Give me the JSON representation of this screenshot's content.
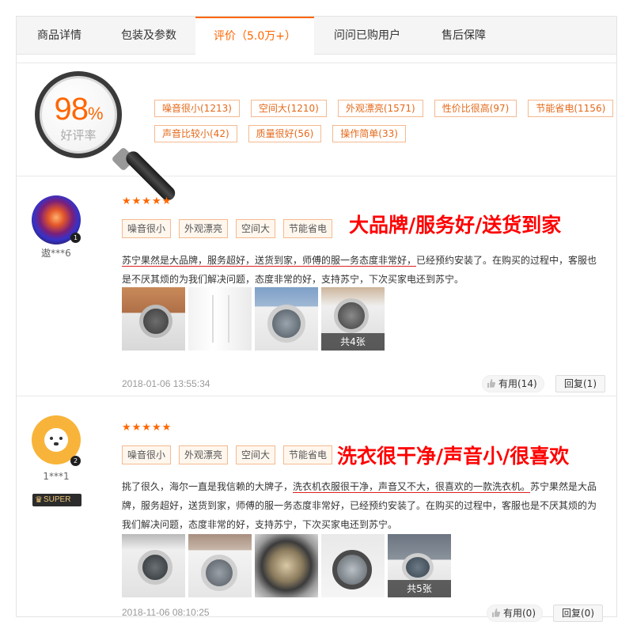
{
  "tabs": [
    {
      "label": "商品详情"
    },
    {
      "label": "包装及参数"
    },
    {
      "label": "评价（5.0万+）"
    },
    {
      "label": "问问已购用户"
    },
    {
      "label": "售后保障"
    }
  ],
  "summary": {
    "rate_value": "98",
    "rate_unit": "%",
    "rate_label": "好评率",
    "tags": [
      [
        "噪音很小(1213)",
        "空间大(1210)",
        "外观漂亮(1571)",
        "性价比很高(97)",
        "节能省电(1156)"
      ],
      [
        "声音比较小(42)",
        "质量很好(56)",
        "操作简单(33)"
      ]
    ]
  },
  "reviews": [
    {
      "username": "遨***6",
      "vip_level": "1",
      "stars": "★★★★★",
      "tags": [
        "噪音很小",
        "外观漂亮",
        "空间大",
        "节能省电"
      ],
      "overlay": "大品牌/服务好/送货到家",
      "text_underlined": "苏宁果然是大品牌，服务超好，送货到家，师傅的服一务态度非常好，",
      "text_rest": "已经预约安装了。在购买的过程中，客服也是不厌其烦的为我们解决问题，态度非常的好，支持苏宁，下次买家电还到苏宁。",
      "photo_count": "共4张",
      "date": "2018-01-06 13:55:34",
      "useful": "有用(14)",
      "reply": "回复(1)"
    },
    {
      "username": "1***1",
      "vip_level": "2",
      "badge": "SUPER",
      "stars": "★★★★★",
      "tags": [
        "噪音很小",
        "外观漂亮",
        "空间大",
        "节能省电"
      ],
      "overlay": "洗衣很干净/声音小/很喜欢",
      "text_before": "挑了很久，海尔一直是我信赖的大牌子，",
      "text_underlined": "洗衣机衣服很干净，声音又不大，很喜欢的一款洗衣机。",
      "text_rest": "苏宁果然是大品牌，服务超好，送货到家，师傅的服一务态度非常好，已经预约安装了。在购买的过程中，客服也是不厌其烦的为我们解决问题，态度非常的好，支持苏宁，下次买家电还到苏宁。",
      "photo_count": "共5张",
      "date": "2018-11-06 08:10:25",
      "useful": "有用(0)",
      "reply": "回复(0)"
    }
  ],
  "colors": {
    "accent": "#ff6600",
    "overlay_red": "#ff0000",
    "tag_border": "#f5b98f"
  },
  "icons": [
    "magnifier-icon",
    "thumbs-up-icon",
    "crown-icon",
    "star-icon"
  ]
}
